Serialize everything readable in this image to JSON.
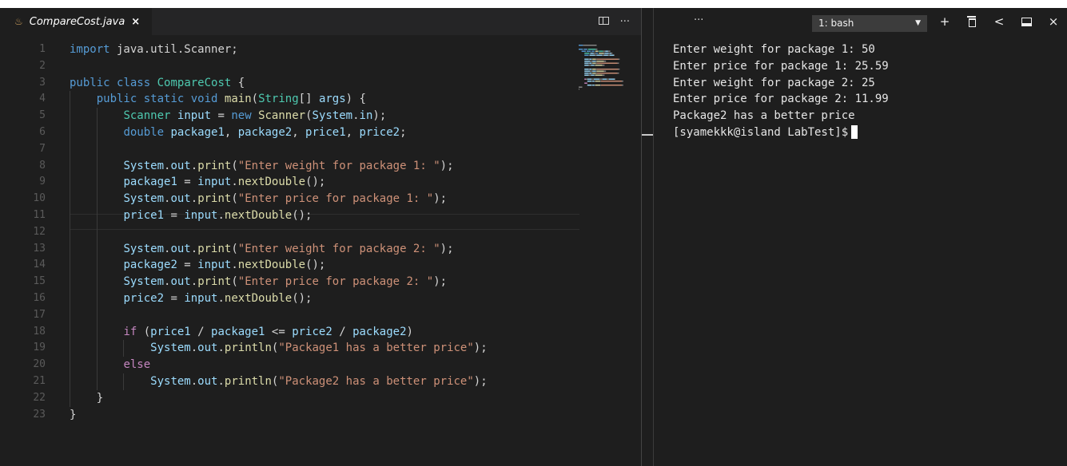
{
  "editor": {
    "tab": {
      "filename": "CompareCost.java",
      "close_symbol": "×"
    },
    "actions": {
      "split_icon": "split-editor-icon",
      "more_label": "···"
    },
    "colors": {
      "keyword": "#569cd6",
      "control": "#c586c0",
      "type": "#4ec9b0",
      "function": "#dcdcaa",
      "variable": "#9cdcfe",
      "string": "#ce9178",
      "text": "#d4d4d4"
    },
    "code_lines": [
      {
        "num": "1",
        "tokens": [
          [
            "kw",
            "import"
          ],
          [
            "pl",
            " java.util.Scanner;"
          ]
        ]
      },
      {
        "num": "2",
        "tokens": []
      },
      {
        "num": "3",
        "tokens": [
          [
            "kw",
            "public"
          ],
          [
            "pl",
            " "
          ],
          [
            "kw",
            "class"
          ],
          [
            "pl",
            " "
          ],
          [
            "ty",
            "CompareCost"
          ],
          [
            "pl",
            " {"
          ]
        ]
      },
      {
        "num": "4",
        "tokens": [
          [
            "pl",
            "    "
          ],
          [
            "kw",
            "public"
          ],
          [
            "pl",
            " "
          ],
          [
            "kw",
            "static"
          ],
          [
            "pl",
            " "
          ],
          [
            "kw",
            "void"
          ],
          [
            "pl",
            " "
          ],
          [
            "fn",
            "main"
          ],
          [
            "pl",
            "("
          ],
          [
            "ty",
            "String"
          ],
          [
            "pl",
            "[] "
          ],
          [
            "var",
            "args"
          ],
          [
            "pl",
            ") {"
          ]
        ]
      },
      {
        "num": "5",
        "tokens": [
          [
            "pl",
            "        "
          ],
          [
            "ty",
            "Scanner"
          ],
          [
            "pl",
            " "
          ],
          [
            "var",
            "input"
          ],
          [
            "pl",
            " = "
          ],
          [
            "kw",
            "new"
          ],
          [
            "pl",
            " "
          ],
          [
            "fn",
            "Scanner"
          ],
          [
            "pl",
            "("
          ],
          [
            "var",
            "System"
          ],
          [
            "pl",
            "."
          ],
          [
            "var",
            "in"
          ],
          [
            "pl",
            ");"
          ]
        ]
      },
      {
        "num": "6",
        "tokens": [
          [
            "pl",
            "        "
          ],
          [
            "kw",
            "double"
          ],
          [
            "pl",
            " "
          ],
          [
            "var",
            "package1"
          ],
          [
            "pl",
            ", "
          ],
          [
            "var",
            "package2"
          ],
          [
            "pl",
            ", "
          ],
          [
            "var",
            "price1"
          ],
          [
            "pl",
            ", "
          ],
          [
            "var",
            "price2"
          ],
          [
            "pl",
            ";"
          ]
        ]
      },
      {
        "num": "7",
        "tokens": []
      },
      {
        "num": "8",
        "tokens": [
          [
            "pl",
            "        "
          ],
          [
            "var",
            "System"
          ],
          [
            "pl",
            "."
          ],
          [
            "var",
            "out"
          ],
          [
            "pl",
            "."
          ],
          [
            "fn",
            "print"
          ],
          [
            "pl",
            "("
          ],
          [
            "str",
            "\"Enter weight for package 1: \""
          ],
          [
            "pl",
            ");"
          ]
        ]
      },
      {
        "num": "9",
        "tokens": [
          [
            "pl",
            "        "
          ],
          [
            "var",
            "package1"
          ],
          [
            "pl",
            " = "
          ],
          [
            "var",
            "input"
          ],
          [
            "pl",
            "."
          ],
          [
            "fn",
            "nextDouble"
          ],
          [
            "pl",
            "();"
          ]
        ]
      },
      {
        "num": "10",
        "tokens": [
          [
            "pl",
            "        "
          ],
          [
            "var",
            "System"
          ],
          [
            "pl",
            "."
          ],
          [
            "var",
            "out"
          ],
          [
            "pl",
            "."
          ],
          [
            "fn",
            "print"
          ],
          [
            "pl",
            "("
          ],
          [
            "str",
            "\"Enter price for package 1: \""
          ],
          [
            "pl",
            ");"
          ]
        ]
      },
      {
        "num": "11",
        "tokens": [
          [
            "pl",
            "        "
          ],
          [
            "var",
            "price1"
          ],
          [
            "pl",
            " = "
          ],
          [
            "var",
            "input"
          ],
          [
            "pl",
            "."
          ],
          [
            "fn",
            "nextDouble"
          ],
          [
            "pl",
            "();"
          ]
        ]
      },
      {
        "num": "12",
        "tokens": []
      },
      {
        "num": "13",
        "tokens": [
          [
            "pl",
            "        "
          ],
          [
            "var",
            "System"
          ],
          [
            "pl",
            "."
          ],
          [
            "var",
            "out"
          ],
          [
            "pl",
            "."
          ],
          [
            "fn",
            "print"
          ],
          [
            "pl",
            "("
          ],
          [
            "str",
            "\"Enter weight for package 2: \""
          ],
          [
            "pl",
            ");"
          ]
        ]
      },
      {
        "num": "14",
        "tokens": [
          [
            "pl",
            "        "
          ],
          [
            "var",
            "package2"
          ],
          [
            "pl",
            " = "
          ],
          [
            "var",
            "input"
          ],
          [
            "pl",
            "."
          ],
          [
            "fn",
            "nextDouble"
          ],
          [
            "pl",
            "();"
          ]
        ]
      },
      {
        "num": "15",
        "tokens": [
          [
            "pl",
            "        "
          ],
          [
            "var",
            "System"
          ],
          [
            "pl",
            "."
          ],
          [
            "var",
            "out"
          ],
          [
            "pl",
            "."
          ],
          [
            "fn",
            "print"
          ],
          [
            "pl",
            "("
          ],
          [
            "str",
            "\"Enter price for package 2: \""
          ],
          [
            "pl",
            ");"
          ]
        ]
      },
      {
        "num": "16",
        "tokens": [
          [
            "pl",
            "        "
          ],
          [
            "var",
            "price2"
          ],
          [
            "pl",
            " = "
          ],
          [
            "var",
            "input"
          ],
          [
            "pl",
            "."
          ],
          [
            "fn",
            "nextDouble"
          ],
          [
            "pl",
            "();"
          ]
        ]
      },
      {
        "num": "17",
        "tokens": []
      },
      {
        "num": "18",
        "tokens": [
          [
            "pl",
            "        "
          ],
          [
            "ctrl",
            "if"
          ],
          [
            "pl",
            " ("
          ],
          [
            "var",
            "price1"
          ],
          [
            "pl",
            " / "
          ],
          [
            "var",
            "package1"
          ],
          [
            "pl",
            " <= "
          ],
          [
            "var",
            "price2"
          ],
          [
            "pl",
            " / "
          ],
          [
            "var",
            "package2"
          ],
          [
            "pl",
            ")"
          ]
        ]
      },
      {
        "num": "19",
        "tokens": [
          [
            "pl",
            "            "
          ],
          [
            "var",
            "System"
          ],
          [
            "pl",
            "."
          ],
          [
            "var",
            "out"
          ],
          [
            "pl",
            "."
          ],
          [
            "fn",
            "println"
          ],
          [
            "pl",
            "("
          ],
          [
            "str",
            "\"Package1 has a better price\""
          ],
          [
            "pl",
            ");"
          ]
        ]
      },
      {
        "num": "20",
        "tokens": [
          [
            "pl",
            "        "
          ],
          [
            "ctrl",
            "else"
          ]
        ]
      },
      {
        "num": "21",
        "tokens": [
          [
            "pl",
            "            "
          ],
          [
            "var",
            "System"
          ],
          [
            "pl",
            "."
          ],
          [
            "var",
            "out"
          ],
          [
            "pl",
            "."
          ],
          [
            "fn",
            "println"
          ],
          [
            "pl",
            "("
          ],
          [
            "str",
            "\"Package2 has a better price\""
          ],
          [
            "pl",
            ");"
          ]
        ]
      },
      {
        "num": "22",
        "tokens": [
          [
            "pl",
            "    }"
          ]
        ]
      },
      {
        "num": "23",
        "tokens": [
          [
            "pl",
            "}"
          ]
        ]
      }
    ]
  },
  "terminal": {
    "more_label": "···",
    "selector": {
      "value": "1: bash",
      "caret": "▼"
    },
    "actions": {
      "add": "+",
      "back": "<",
      "close": "×"
    },
    "output_lines": [
      "Enter weight for package 1: 50",
      "Enter price for package 1: 25.59",
      "Enter weight for package 2: 25",
      "Enter price for package 2: 11.99",
      "Package2 has a better price"
    ],
    "prompt": "[syamekkk@island LabTest]$"
  }
}
